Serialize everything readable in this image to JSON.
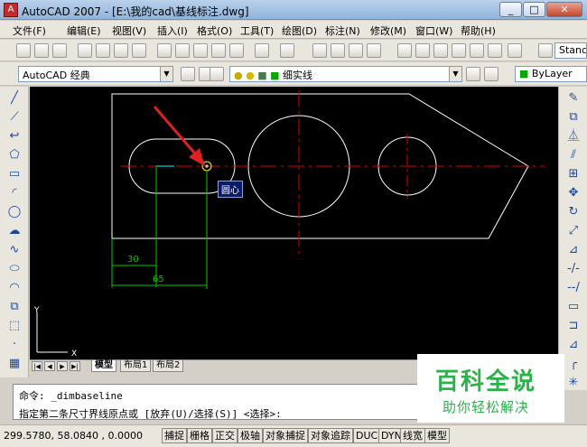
{
  "window": {
    "title": "AutoCAD 2007 - [E:\\我的cad\\基线标注.dwg]",
    "btn_min": "_",
    "btn_max": "□",
    "btn_close": "✕"
  },
  "menu": [
    "文件(F)",
    "编辑(E)",
    "视图(V)",
    "插入(I)",
    "格式(O)",
    "工具(T)",
    "绘图(D)",
    "标注(N)",
    "修改(M)",
    "窗口(W)",
    "帮助(H)"
  ],
  "toolbar": {
    "workspace": "AutoCAD 经典",
    "layer": "细实线",
    "linetype": "ByLayer",
    "style": "Stanc"
  },
  "drawing": {
    "dim_small": "30",
    "dim_large": "65",
    "snap_tooltip": "圆心",
    "ucs_y": "Y",
    "ucs_x": "X",
    "colors": {
      "outline": "#ffffff",
      "centerline": "#e00000",
      "dimension": "#00cc00",
      "arrow": "#e02020",
      "snap": "#ffff00"
    }
  },
  "layout_tabs": {
    "model": "模型",
    "layout1": "布局1",
    "layout2": "布局2"
  },
  "command": {
    "line1": "命令: _dimbaseline",
    "line2": "指定第二条尺寸界线原点或 [放弃(U)/选择(S)] <选择>:"
  },
  "status": {
    "coords": "299.5780, 58.0840 , 0.0000",
    "buttons": [
      "捕捉",
      "栅格",
      "正交",
      "极轴",
      "对象捕捉",
      "对象追踪",
      "DUCS",
      "DYN",
      "线宽",
      "模型"
    ]
  },
  "watermark": {
    "title": "百科全说",
    "subtitle": "助你轻松解决"
  }
}
